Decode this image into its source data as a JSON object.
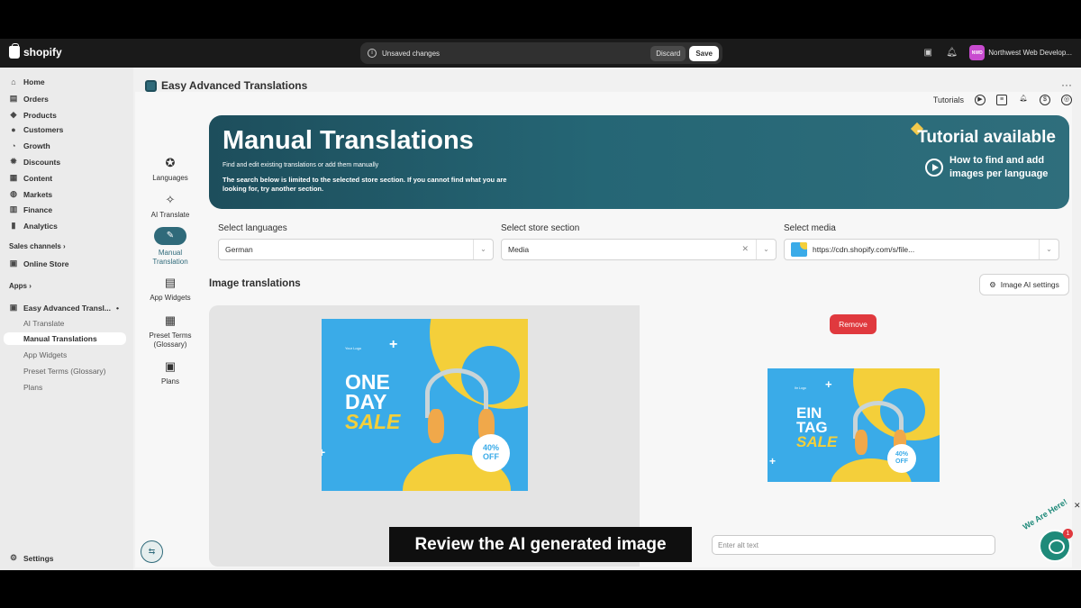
{
  "topbar": {
    "brand": "shopify",
    "unsaved_text": "Unsaved changes",
    "discard_label": "Discard",
    "save_label": "Save",
    "store_initials": "NWD",
    "store_name": "Northwest Web Develop..."
  },
  "sidebar": {
    "items": [
      {
        "label": "Home",
        "icon": "home-icon"
      },
      {
        "label": "Orders",
        "icon": "orders-icon"
      },
      {
        "label": "Products",
        "icon": "tag-icon"
      },
      {
        "label": "Customers",
        "icon": "person-icon"
      },
      {
        "label": "Growth",
        "icon": "growth-icon"
      },
      {
        "label": "Discounts",
        "icon": "discount-icon"
      },
      {
        "label": "Content",
        "icon": "content-icon"
      },
      {
        "label": "Markets",
        "icon": "globe-icon"
      },
      {
        "label": "Finance",
        "icon": "bank-icon"
      },
      {
        "label": "Analytics",
        "icon": "chart-icon"
      }
    ],
    "sales_channels": "Sales channels",
    "online_store": "Online Store",
    "apps": "Apps",
    "app_name": "Easy Advanced Transl...",
    "app_subitems": [
      "AI Translate",
      "Manual Translations",
      "App Widgets",
      "Preset Terms (Glossary)",
      "Plans"
    ],
    "settings": "Settings"
  },
  "app": {
    "title": "Easy Advanced Translations",
    "tutorials_label": "Tutorials",
    "nav": [
      {
        "label": "Languages"
      },
      {
        "label": "AI Translate"
      },
      {
        "label": "Manual Translation"
      },
      {
        "label": "App Widgets"
      },
      {
        "label": "Preset Terms (Glossary)"
      },
      {
        "label": "Plans"
      }
    ]
  },
  "hero": {
    "title": "Manual Translations",
    "sub1": "Find and edit existing translations or add them manually",
    "sub2": "The search below is limited to the selected store section. If you cannot find what you are looking for, try another section.",
    "tutorial": "Tutorial available",
    "howto": "How to find and add images per language"
  },
  "filters": {
    "languages_label": "Select languages",
    "languages_value": "German",
    "section_label": "Select store section",
    "section_value": "Media",
    "media_label": "Select media",
    "media_value": "https://cdn.shopify.com/s/file..."
  },
  "images": {
    "section_title": "Image translations",
    "ai_settings": "Image AI settings",
    "remove": "Remove",
    "alt_placeholder": "Enter alt text",
    "original": {
      "line1": "ONE",
      "line2": "DAY",
      "line3": "SALE",
      "badge_pct": "40%",
      "badge_off": "OFF",
      "brand": "Your Logo"
    },
    "translated": {
      "line1": "EIN",
      "line2": "TAG",
      "line3": "SALE",
      "badge_pct": "40%",
      "badge_off": "OFF",
      "brand": "Ihr Logo"
    }
  },
  "caption": "Review the AI generated image",
  "chat": {
    "badge": "1",
    "tagline": "We Are Here!"
  }
}
